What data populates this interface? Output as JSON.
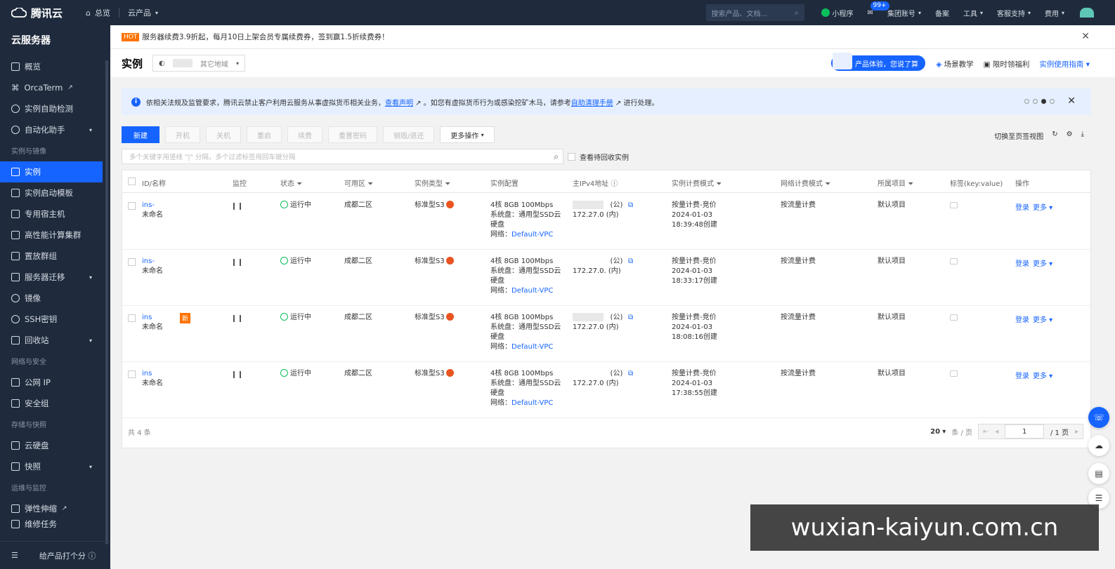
{
  "topbar": {
    "brand": "腾讯云",
    "home": "总览",
    "products": "云产品",
    "search_placeholder": "搜索产品、文档...",
    "mini_program": "小程序",
    "msg_badge": "99+",
    "account": "集团账号",
    "filing": "备案",
    "tools": "工具",
    "support": "客服支持",
    "billing": "费用"
  },
  "sidebar": {
    "title": "云服务器",
    "items": [
      {
        "label": "概览"
      },
      {
        "label": "OrcaTerm"
      },
      {
        "label": "实例自助检测"
      },
      {
        "label": "自动化助手"
      }
    ],
    "group1": "实例与镜像",
    "items2": [
      {
        "label": "实例"
      },
      {
        "label": "实例启动模板"
      },
      {
        "label": "专用宿主机"
      },
      {
        "label": "高性能计算集群"
      },
      {
        "label": "置放群组"
      },
      {
        "label": "服务器迁移"
      },
      {
        "label": "镜像"
      },
      {
        "label": "SSH密钥"
      },
      {
        "label": "回收站"
      }
    ],
    "group2": "网络与安全",
    "items3": [
      {
        "label": "公网 IP"
      },
      {
        "label": "安全组"
      }
    ],
    "group3": "存储与快照",
    "items4": [
      {
        "label": "云硬盘"
      },
      {
        "label": "快照"
      }
    ],
    "group4": "运维与监控",
    "items5": [
      {
        "label": "弹性伸缩"
      },
      {
        "label": "维修任务"
      }
    ],
    "feedback": "给产品打个分"
  },
  "notice": {
    "hot": "HOT",
    "text": "服务器续费3.9折起，每月10日上架会员专属续费券，签到赢1.5折续费券！"
  },
  "page": {
    "title": "实例",
    "region_other": "其它地域",
    "promo": "产品体验，您说了算",
    "scene": "场景教学",
    "benefit": "限时领福利",
    "guide": "实例使用指南"
  },
  "alert": {
    "text1": "依相关法规及监管要求，腾讯云禁止客户利用云服务从事虚拟货币相关业务，",
    "link1": "查看声明",
    "text2": "。如您有虚拟货币行为或感染挖矿木马，请参考",
    "link2": "自助清理手册",
    "text3": "进行处理。"
  },
  "toolbar": {
    "new": "新建",
    "start": "开机",
    "stop": "关机",
    "restart": "重启",
    "renew": "续费",
    "reset_pwd": "重置密码",
    "destroy": "销毁/退还",
    "more": "更多操作",
    "switch_view": "切换至页签视图"
  },
  "filter": {
    "placeholder": "多个关键字用竖线 \"|\" 分隔，多个过滤标签用回车键分隔",
    "recycle": "查看待回收实例"
  },
  "table": {
    "headers": [
      "ID/名称",
      "监控",
      "状态",
      "可用区",
      "实例类型",
      "实例配置",
      "主IPv4地址",
      "实例计费模式",
      "网络计费模式",
      "所属项目",
      "标签(key:value)",
      "操作"
    ],
    "rows": [
      {
        "id": "ins-",
        "name": "未命名",
        "status": "运行中",
        "zone": "成都二区",
        "type": "标准型S3",
        "cfg1": "4核 8GB 100Mbps",
        "cfg2": "系统盘：通用型SSD云",
        "cfg3": "硬盘",
        "net_label": "网络：",
        "vpc": "Default-VPC",
        "ip_pub": "(公)",
        "ip_priv": "172.27.0",
        "ip_priv_tag": "(内)",
        "bill1": "按量计费-竞价",
        "bill2": "2024-01-03",
        "bill3": "18:39:48创建",
        "netbill": "按流量计费",
        "project": "默认项目",
        "op_login": "登录",
        "op_more": "更多"
      },
      {
        "id": "ins-",
        "name": "未命名",
        "status": "运行中",
        "zone": "成都二区",
        "type": "标准型S3",
        "cfg1": "4核 8GB 100Mbps",
        "cfg2": "系统盘：通用型SSD云",
        "cfg3": "硬盘",
        "net_label": "网络：",
        "vpc": "Default-VPC",
        "ip_pub": "(公)",
        "ip_priv": "172.27.0.",
        "ip_priv_tag": "(内)",
        "bill1": "按量计费-竞价",
        "bill2": "2024-01-03",
        "bill3": "18:33:17创建",
        "netbill": "按流量计费",
        "project": "默认项目",
        "op_login": "登录",
        "op_more": "更多"
      },
      {
        "id": "ins",
        "name": "未命名",
        "badge": "新",
        "status": "运行中",
        "zone": "成都二区",
        "type": "标准型S3",
        "cfg1": "4核 8GB 100Mbps",
        "cfg2": "系统盘：通用型SSD云",
        "cfg3": "硬盘",
        "net_label": "网络：",
        "vpc": "Default-VPC",
        "ip_pub": "(公)",
        "ip_priv": "172.27.0",
        "ip_priv_tag": "(内)",
        "bill1": "按量计费-竞价",
        "bill2": "2024-01-03",
        "bill3": "18:08:16创建",
        "netbill": "按流量计费",
        "project": "默认项目",
        "op_login": "登录",
        "op_more": "更多"
      },
      {
        "id": "ins",
        "name": "未命名",
        "status": "运行中",
        "zone": "成都二区",
        "type": "标准型S3",
        "cfg1": "4核 8GB 100Mbps",
        "cfg2": "系统盘：通用型SSD云",
        "cfg3": "硬盘",
        "net_label": "网络：",
        "vpc": "Default-VPC",
        "ip_pub": "(公)",
        "ip_priv": "172.27.0",
        "ip_priv_tag": "(内)",
        "bill1": "按量计费-竞价",
        "bill2": "2024-01-03",
        "bill3": "17:38:55创建",
        "netbill": "按流量计费",
        "project": "默认项目",
        "op_login": "登录",
        "op_more": "更多"
      }
    ],
    "total": "共 4 条",
    "page_size": "20",
    "per_page": "条 / 页",
    "page_num": "1",
    "page_total": "/ 1 页"
  },
  "watermark": "wuxian-kaiyun.com.cn",
  "colors": {
    "accent": "#1664ff",
    "sidebar_bg": "#1f2b3d",
    "running": "#0abf5b",
    "hot": "#ff7200"
  }
}
